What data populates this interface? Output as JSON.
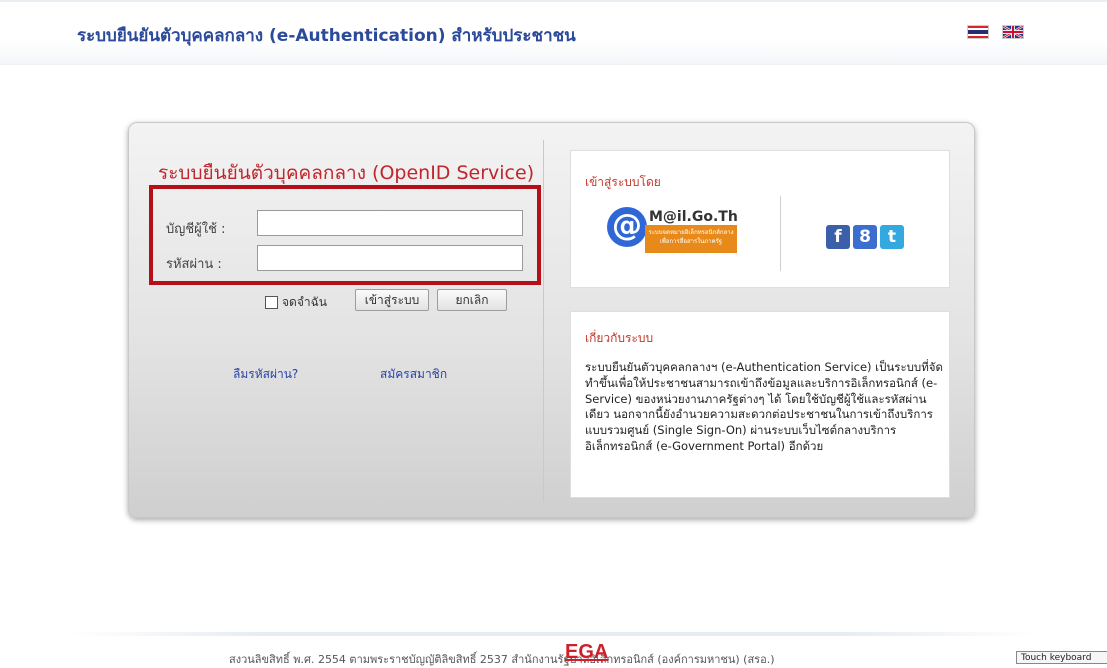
{
  "header": {
    "title": "ระบบยืนยันตัวบุคคลกลาง (e-Authentication) สำหรับประชาชน",
    "flags": [
      "thai-flag-icon",
      "uk-flag-icon"
    ]
  },
  "login": {
    "heading": "ระบบยืนยันตัวบุคคลกลาง (OpenID Service)",
    "username_label": "บัญชีผู้ใช้ :",
    "username_value": "",
    "password_label": "รหัสผ่าน :",
    "password_value": "",
    "remember_label": "จดจำฉัน",
    "login_button": "เข้าสู่ระบบ",
    "cancel_button": "ยกเลิก",
    "forgot_link": "ลืมรหัสผ่าน?",
    "register_link": "สมัครสมาชิก"
  },
  "login_via": {
    "heading": "เข้าสู่ระบบโดย",
    "mail_logo_text": "M@il.Go.Th",
    "mail_logo_subtext": "ระบบจดหมายอิเล็กทรอนิกส์กลาง เพื่อการสื่อสารในภาครัฐ",
    "social_icons": [
      "facebook-icon",
      "google-plus-icon",
      "twitter-icon"
    ]
  },
  "about": {
    "heading": "เกี่ยวกับระบบ",
    "body": "ระบบยืนยันตัวบุคคลกลางฯ (e-Authentication Service) เป็นระบบที่จัดทำขึ้นเพื่อให้ประชาชนสามารถเข้าถึงข้อมูลและบริการอิเล็กทรอนิกส์ (e-Service) ของหน่วยงานภาครัฐต่างๆ ได้ โดยใช้บัญชีผู้ใช้และรหัสผ่านเดียว นอกจากนี้ยังอำนวยความสะดวกต่อประชาชนในการเข้าถึงบริการแบบรวมศูนย์ (Single Sign-On) ผ่านระบบเว็บไซต์กลางบริการอิเล็กทรอนิกส์ (e-Government Portal) อีกด้วย"
  },
  "footer": {
    "copyright": "สงวนลิขสิทธิ์ พ.ศ. 2554 ตามพระราชบัญญัติลิขสิทธิ์ 2537 สำนักงานรัฐบาลอิเล็กทรอนิกส์ (องค์การมหาชน) (สรอ.)",
    "logo_text": "EGA"
  },
  "system": {
    "touch_keyboard_label": "Touch keyboard"
  },
  "colors": {
    "title_blue": "#2c4a9a",
    "heading_red": "#c0262d",
    "highlight_box": "#b5101a",
    "link_blue": "#2a43a6",
    "facebook": "#3b5fa8",
    "google": "#3c6ecf",
    "twitter": "#33a9e0"
  }
}
